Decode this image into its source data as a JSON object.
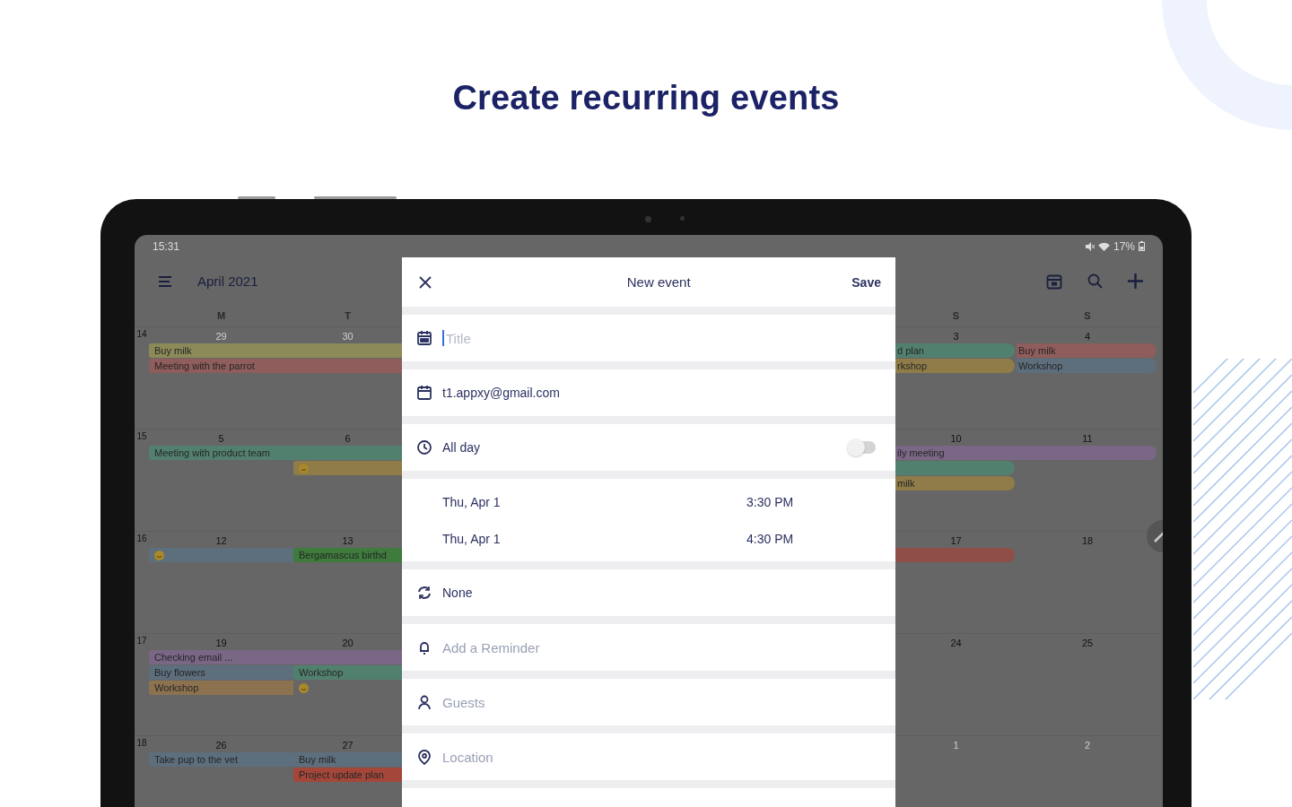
{
  "headline": "Create recurring events",
  "status_bar": {
    "time": "15:31",
    "battery": "17%"
  },
  "app_bar": {
    "title": "April 2021"
  },
  "calendar": {
    "weekdays_left": [
      "M",
      "T"
    ],
    "weekdays_right": [
      "S",
      "S"
    ],
    "weeks": [
      {
        "number": "14",
        "days_left": [
          {
            "label": "29",
            "outside": true
          },
          {
            "label": "30",
            "outside": true
          }
        ],
        "days_right": [
          {
            "label": "3",
            "outside": false
          },
          {
            "label": "4",
            "outside": false
          }
        ],
        "lanes_left": [
          [
            {
              "kind": "bar",
              "text": "Buy milk",
              "color": "#8d8a5a",
              "wide": true
            }
          ],
          [
            {
              "kind": "bar",
              "text": "Meeting with the parrot",
              "color": "#8f5d5b",
              "wide": true
            }
          ]
        ],
        "lanes_right": [
          [
            {
              "kind": "bar",
              "text": "d plan",
              "color": "#52806f",
              "wide": false
            },
            {
              "kind": "bar",
              "text": "Buy milk",
              "color": "#8f5d5b",
              "wide": false
            }
          ],
          [
            {
              "kind": "bar",
              "text": "rkshop",
              "color": "#8f7c48",
              "wide": false
            },
            {
              "kind": "bar",
              "text": "Workshop",
              "color": "#5d6e7d",
              "wide": false
            }
          ]
        ]
      },
      {
        "number": "15",
        "days_left": [
          {
            "label": "5",
            "outside": false
          },
          {
            "label": "6",
            "outside": false
          }
        ],
        "days_right": [
          {
            "label": "10",
            "outside": false
          },
          {
            "label": "11",
            "outside": false
          }
        ],
        "lanes_left": [
          [
            {
              "kind": "bar",
              "text": "Meeting with product team",
              "color": "#52806f",
              "wide": true
            }
          ],
          [
            {
              "kind": "empty"
            },
            {
              "kind": "smiley",
              "color": "#8f7c48",
              "wide": false
            }
          ]
        ],
        "lanes_right": [
          [
            {
              "kind": "bar",
              "text": "ily meeting",
              "color": "#7a6786",
              "wide": true
            }
          ],
          [
            {
              "kind": "bar",
              "color": "#52806f",
              "wide": false
            }
          ],
          [
            {
              "kind": "bar",
              "text": "milk",
              "color": "#8f7c48",
              "wide": false
            }
          ]
        ]
      },
      {
        "number": "16",
        "days_left": [
          {
            "label": "12",
            "outside": false
          },
          {
            "label": "13",
            "outside": false
          }
        ],
        "days_right": [
          {
            "label": "17",
            "outside": false
          },
          {
            "label": "18",
            "outside": false
          }
        ],
        "lanes_left": [
          [
            {
              "kind": "smiley",
              "color": "#5d6e7d",
              "wide": false
            },
            {
              "kind": "bar",
              "text": "Bergamascus birthd",
              "color": "#3e7b3c",
              "wide": false
            }
          ]
        ],
        "lanes_right": [
          [
            {
              "kind": "bar",
              "color": "#8f4f48",
              "wide": false
            }
          ]
        ]
      },
      {
        "number": "17",
        "days_left": [
          {
            "label": "19",
            "outside": false
          },
          {
            "label": "20",
            "outside": false
          }
        ],
        "days_right": [
          {
            "label": "24",
            "outside": false
          },
          {
            "label": "25",
            "outside": false
          }
        ],
        "lanes_left": [
          [
            {
              "kind": "bar",
              "text": "Checking email ...",
              "color": "#7a6786",
              "wide": true
            }
          ],
          [
            {
              "kind": "bar",
              "text": "Buy flowers",
              "color": "#5d6e7d",
              "wide": false
            },
            {
              "kind": "bar",
              "text": "Workshop",
              "color": "#52806f",
              "wide": false
            }
          ],
          [
            {
              "kind": "bar",
              "text": "Workshop",
              "color": "#8d7250",
              "wide": false
            },
            {
              "kind": "smiley",
              "wide": false
            }
          ]
        ]
      },
      {
        "number": "18",
        "days_left": [
          {
            "label": "26",
            "outside": false
          },
          {
            "label": "27",
            "outside": false
          }
        ],
        "days_right": [
          {
            "label": "1",
            "outside": true
          },
          {
            "label": "2",
            "outside": true
          }
        ],
        "lanes_left": [
          [
            {
              "kind": "bar",
              "text": "Take pup to the vet",
              "color": "#5d6e7d",
              "wide": false
            },
            {
              "kind": "bar",
              "text": "Buy milk",
              "color": "#5d6e7d",
              "wide": false
            }
          ],
          [
            {
              "kind": "empty"
            },
            {
              "kind": "bar",
              "text": "Project update plan",
              "color": "#a4473a",
              "wide": false
            }
          ]
        ]
      }
    ]
  },
  "form": {
    "title": "New event",
    "save": "Save",
    "rows": [
      {
        "kind": "title",
        "placeholder": "Title"
      },
      {
        "kind": "account",
        "text": "t1.appxy@gmail.com",
        "hint": false
      },
      {
        "kind": "allday",
        "text": "All day",
        "hint": false,
        "on": false
      },
      {
        "kind": "times",
        "start_date": "Thu, Apr 1",
        "start_time": "3:30 PM",
        "end_date": "Thu, Apr 1",
        "end_time": "4:30 PM"
      },
      {
        "kind": "repeat",
        "text": "None",
        "hint": false
      },
      {
        "kind": "reminder",
        "text": "Add a Reminder",
        "hint": true
      },
      {
        "kind": "guests",
        "text": "Guests",
        "hint": true
      },
      {
        "kind": "location",
        "text": "Location",
        "hint": true
      }
    ]
  }
}
